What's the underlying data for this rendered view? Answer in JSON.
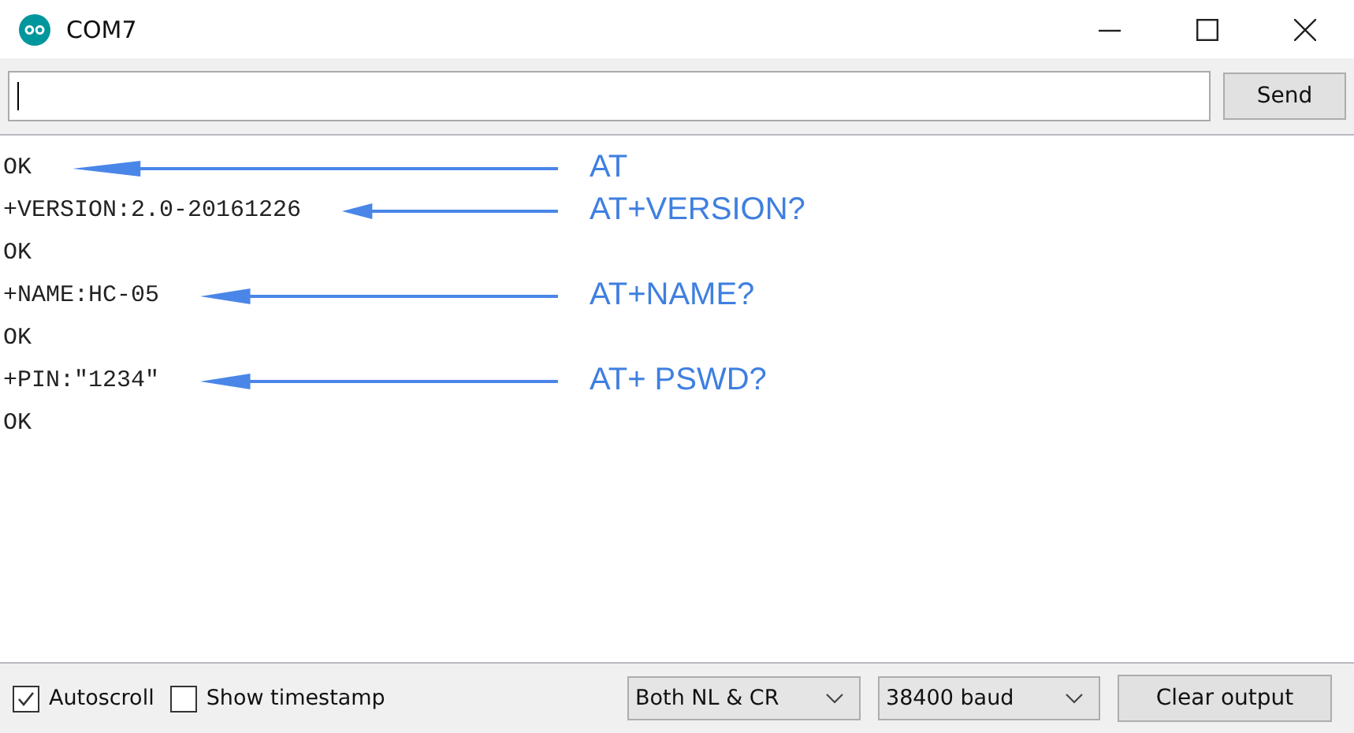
{
  "window": {
    "title": "COM7"
  },
  "input": {
    "button": "Send"
  },
  "output": [
    {
      "text": "OK",
      "annotation": "AT"
    },
    {
      "text": "+VERSION:2.0-20161226",
      "annotation": "AT+VERSION?"
    },
    {
      "text": "OK"
    },
    {
      "text": "+NAME:HC-05",
      "annotation": "AT+NAME?"
    },
    {
      "text": "OK"
    },
    {
      "text": "+PIN:\"1234\"",
      "annotation": "AT+ PSWD?"
    },
    {
      "text": "OK"
    }
  ],
  "footer": {
    "checkboxes": [
      {
        "label": "Autoscroll",
        "checked": true
      },
      {
        "label": "Show timestamp",
        "checked": false
      }
    ],
    "dropdowns": [
      "Both NL & CR",
      "38400 baud"
    ],
    "button": "Clear output"
  }
}
